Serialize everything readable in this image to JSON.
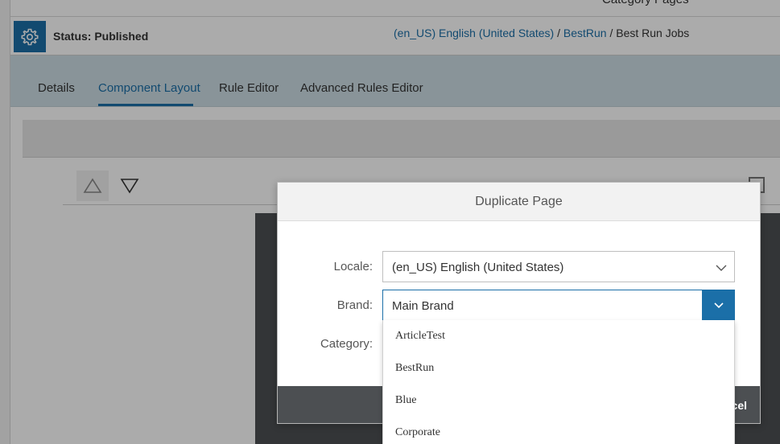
{
  "top": {
    "cut_title": "Category Pages"
  },
  "status": {
    "label": "Status:",
    "value": "Published"
  },
  "breadcrumb": {
    "locale": "(en_US) English (United States)",
    "sep1": " / ",
    "brand": "BestRun",
    "sep2": " / ",
    "page": "Best Run Jobs"
  },
  "tabs": [
    {
      "label": "Details"
    },
    {
      "label": "Component Layout"
    },
    {
      "label": "Rule Editor"
    },
    {
      "label": "Advanced Rules Editor"
    }
  ],
  "active_tab": "Component Layout",
  "dialog": {
    "title": "Duplicate Page",
    "locale_label": "Locale:",
    "locale_value": "(en_US) English (United States)",
    "brand_label": "Brand:",
    "brand_value": "Main Brand",
    "category_label": "Category:",
    "cancel_label": "Cancel"
  },
  "brand_options": [
    {
      "label": "ArticleTest"
    },
    {
      "label": "BestRun"
    },
    {
      "label": "Blue"
    },
    {
      "label": "Corporate"
    }
  ],
  "colors": {
    "accent": "#1b6fa8",
    "tab_bar": "#ccdde4",
    "footer": "#4c4f52"
  },
  "icons": {
    "settings": "gear-icon",
    "move_up": "triangle-up-icon",
    "move_down": "triangle-down-icon",
    "dropdown": "chevron-down-icon"
  }
}
